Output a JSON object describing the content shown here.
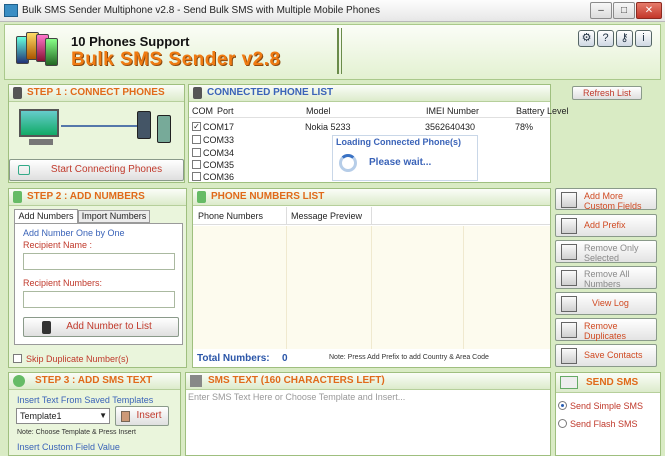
{
  "window": {
    "title": "Bulk SMS Sender Multiphone v2.8 - Send Bulk SMS with Multiple Mobile Phones",
    "minimize": "–",
    "maximize": "□",
    "close": "✕"
  },
  "header": {
    "tagline": "10 Phones Support",
    "app_name": "Bulk SMS Sender v2.8",
    "tool_icons": [
      "settings-icon",
      "help-icon",
      "key-icon",
      "info-icon"
    ]
  },
  "step1": {
    "title": "STEP 1 : CONNECT PHONES",
    "start_button": "Start Connecting Phones"
  },
  "connected": {
    "title": "CONNECTED PHONE LIST",
    "refresh_button": "Refresh List",
    "columns": [
      "COM",
      "Port",
      "Model",
      "IMEI Number",
      "Battery Level"
    ],
    "rows": [
      {
        "checked": true,
        "port": "COM17",
        "model": "Nokia 5233",
        "imei": "3562640430",
        "battery": "78%"
      },
      {
        "checked": false,
        "port": "COM33",
        "model": "",
        "imei": "",
        "battery": ""
      },
      {
        "checked": false,
        "port": "COM34",
        "model": "",
        "imei": "",
        "battery": ""
      },
      {
        "checked": false,
        "port": "COM35",
        "model": "",
        "imei": "",
        "battery": ""
      },
      {
        "checked": false,
        "port": "COM36",
        "model": "",
        "imei": "",
        "battery": ""
      }
    ],
    "loading_title": "Loading Connected Phone(s)",
    "loading_text": "Please wait..."
  },
  "step2": {
    "title": "STEP 2 : ADD NUMBERS",
    "tabs": [
      "Add Numbers",
      "Import Numbers"
    ],
    "group_label": "Add Number One by One",
    "recipient_name_label": "Recipient Name :",
    "recipient_numbers_label": "Recipient Numbers:",
    "add_button": "Add Number to List",
    "skip_duplicate": "Skip Duplicate Number(s)"
  },
  "numbers": {
    "title": "PHONE NUMBERS LIST",
    "columns": [
      "Phone Numbers",
      "Message Preview"
    ],
    "total_label": "Total Numbers:",
    "total_value": "0",
    "note": "Note: Press Add Prefix to add Country & Area Code"
  },
  "side_buttons": [
    {
      "label": "Add More Custom Fields",
      "icon": "custom-fields-icon",
      "enabled": true
    },
    {
      "label": "Add Prefix",
      "icon": "prefix-icon",
      "enabled": true
    },
    {
      "label": "Remove Only Selected",
      "icon": "remove-selected-icon",
      "enabled": false
    },
    {
      "label": "Remove All Numbers",
      "icon": "trash-icon",
      "enabled": false
    },
    {
      "label": "View Log",
      "icon": "log-icon",
      "enabled": true
    },
    {
      "label": "Remove Duplicates",
      "icon": "duplicates-icon",
      "enabled": true
    },
    {
      "label": "Save Contacts",
      "icon": "contacts-book-icon",
      "enabled": true
    }
  ],
  "step3": {
    "title": "STEP 3 : ADD SMS TEXT",
    "saved_templates_label": "Insert Text From Saved Templates",
    "template_value": "Template1",
    "insert_button": "Insert",
    "note": "Note: Choose Template & Press Insert",
    "custom_field_label": "Insert Custom Field Value"
  },
  "sms_text": {
    "title": "SMS TEXT (160 CHARACTERS LEFT)",
    "placeholder": "Enter SMS Text Here or Choose Template and Insert..."
  },
  "send": {
    "title": "SEND SMS",
    "options": [
      "Send Simple SMS",
      "Send Flash SMS"
    ],
    "selected": 0
  },
  "colors": {
    "accent_orange": "#f07b12",
    "heading_red": "#e06a1a",
    "panel_green": "#d9ebc4",
    "link_blue": "#3a63b8"
  }
}
